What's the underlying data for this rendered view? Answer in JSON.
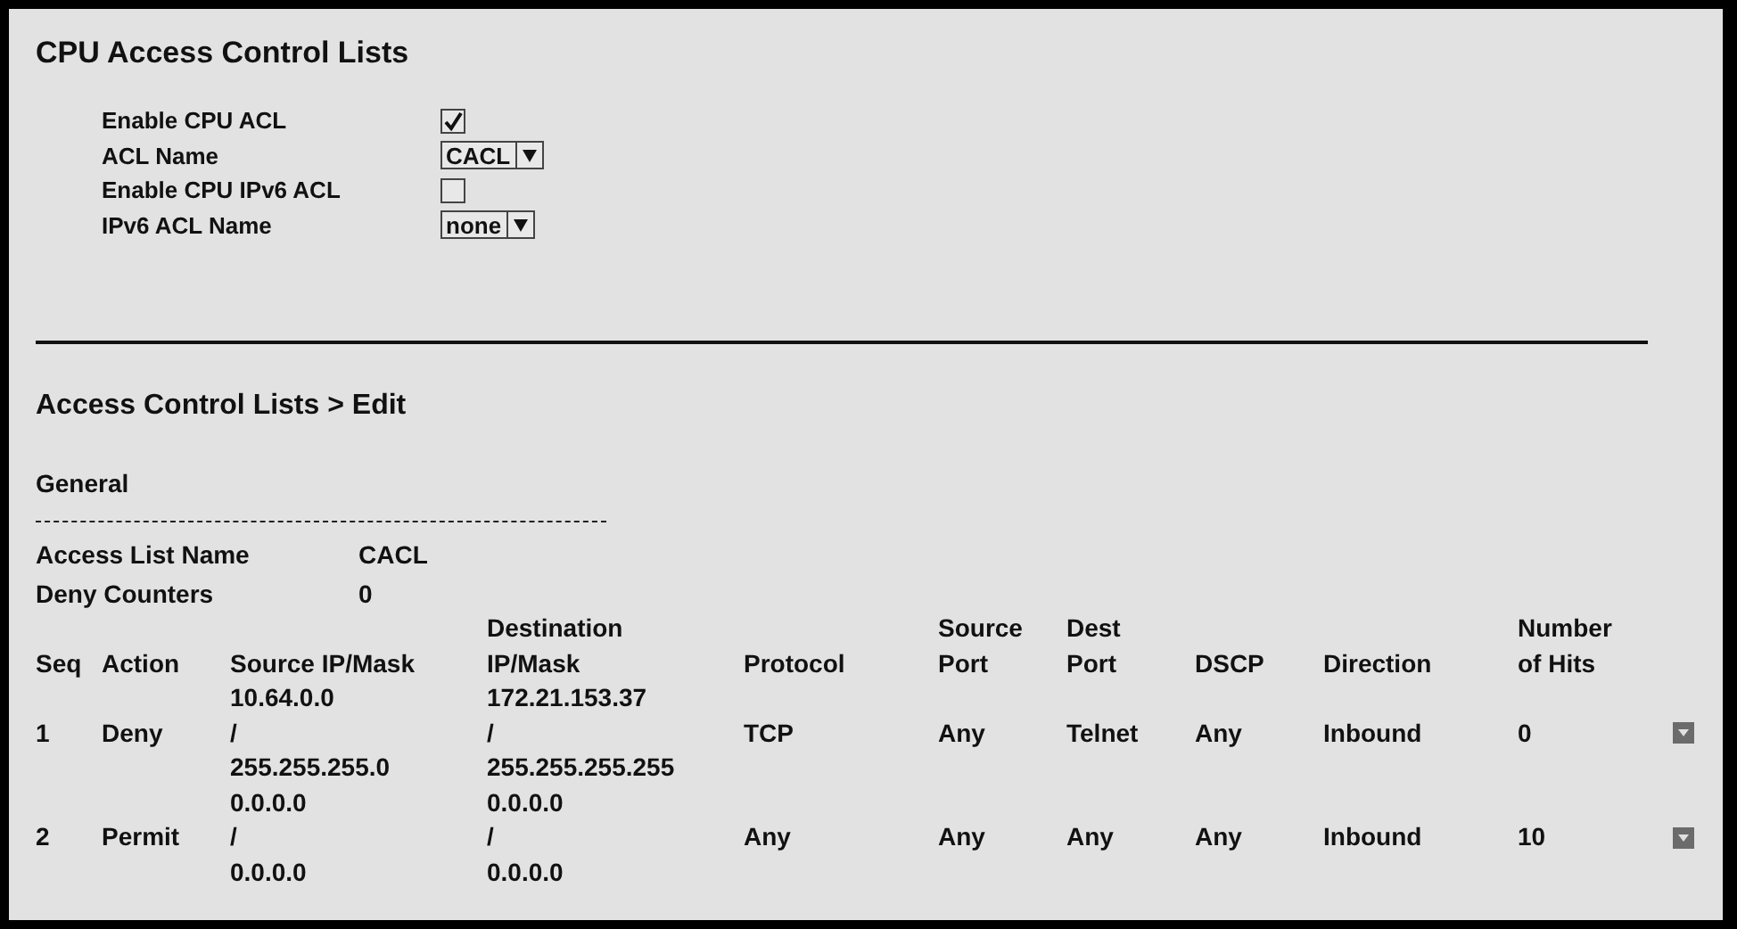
{
  "cpu_acl": {
    "title": "CPU Access Control Lists",
    "fields": [
      {
        "label": "Enable CPU ACL",
        "kind": "checkbox",
        "checked": true
      },
      {
        "label": "ACL Name",
        "kind": "select",
        "value": "CACL"
      },
      {
        "label": "Enable CPU IPv6 ACL",
        "kind": "checkbox",
        "checked": false
      },
      {
        "label": "IPv6 ACL Name",
        "kind": "select",
        "value": "none"
      }
    ]
  },
  "edit": {
    "title": "Access Control Lists > Edit",
    "section": "General",
    "info": [
      {
        "label": "Access List Name",
        "value": "CACL"
      },
      {
        "label": "Deny Counters",
        "value": "0"
      }
    ],
    "columns": [
      [
        "Seq"
      ],
      [
        "Action"
      ],
      [
        "Source IP/Mask"
      ],
      [
        "Destination",
        "IP/Mask"
      ],
      [
        "Protocol"
      ],
      [
        "Source",
        "Port"
      ],
      [
        "Dest",
        "Port"
      ],
      [
        "DSCP"
      ],
      [
        "Direction"
      ],
      [
        "Number",
        "of Hits"
      ]
    ],
    "rows": [
      {
        "seq": "1",
        "action": "Deny",
        "source": [
          "10.64.0.0",
          "/",
          "255.255.255.0"
        ],
        "destination": [
          "172.21.153.37",
          "/",
          "255.255.255.255"
        ],
        "protocol": "TCP",
        "source_port": "Any",
        "dest_port": "Telnet",
        "dscp": "Any",
        "direction": "Inbound",
        "hits": "0"
      },
      {
        "seq": "2",
        "action": "Permit",
        "source": [
          "0.0.0.0",
          "/",
          "0.0.0.0"
        ],
        "destination": [
          "0.0.0.0",
          "/",
          "0.0.0.0"
        ],
        "protocol": "Any",
        "source_port": "Any",
        "dest_port": "Any",
        "dscp": "Any",
        "direction": "Inbound",
        "hits": "10"
      }
    ]
  }
}
